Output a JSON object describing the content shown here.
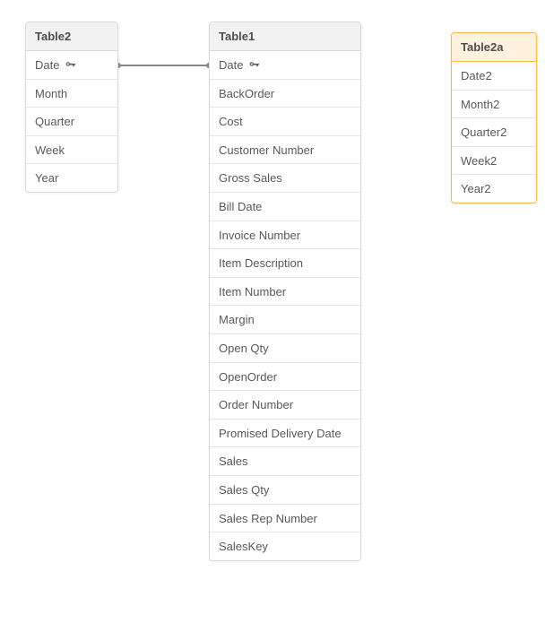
{
  "tables": {
    "table2": {
      "title": "Table2",
      "fields": [
        {
          "label": "Date",
          "key": true
        },
        {
          "label": "Month",
          "key": false
        },
        {
          "label": "Quarter",
          "key": false
        },
        {
          "label": "Week",
          "key": false
        },
        {
          "label": "Year",
          "key": false
        }
      ]
    },
    "table1": {
      "title": "Table1",
      "fields": [
        {
          "label": "Date",
          "key": true
        },
        {
          "label": "BackOrder",
          "key": false
        },
        {
          "label": "Cost",
          "key": false
        },
        {
          "label": "Customer Number",
          "key": false
        },
        {
          "label": "Gross Sales",
          "key": false
        },
        {
          "label": "Bill Date",
          "key": false
        },
        {
          "label": "Invoice Number",
          "key": false
        },
        {
          "label": "Item Description",
          "key": false
        },
        {
          "label": "Item Number",
          "key": false
        },
        {
          "label": "Margin",
          "key": false
        },
        {
          "label": "Open Qty",
          "key": false
        },
        {
          "label": "OpenOrder",
          "key": false
        },
        {
          "label": "Order Number",
          "key": false
        },
        {
          "label": "Promised Delivery Date",
          "key": false
        },
        {
          "label": "Sales",
          "key": false
        },
        {
          "label": "Sales Qty",
          "key": false
        },
        {
          "label": "Sales Rep Number",
          "key": false
        },
        {
          "label": "SalesKey",
          "key": false
        }
      ]
    },
    "table2a": {
      "title": "Table2a",
      "highlight": true,
      "fields": [
        {
          "label": "Date2",
          "key": false
        },
        {
          "label": "Month2",
          "key": false
        },
        {
          "label": "Quarter2",
          "key": false
        },
        {
          "label": "Week2",
          "key": false
        },
        {
          "label": "Year2",
          "key": false
        }
      ]
    }
  },
  "connection": {
    "from": "table2.Date",
    "to": "table1.Date"
  },
  "colors": {
    "line": "#888888",
    "highlight": "#ffb84d"
  }
}
